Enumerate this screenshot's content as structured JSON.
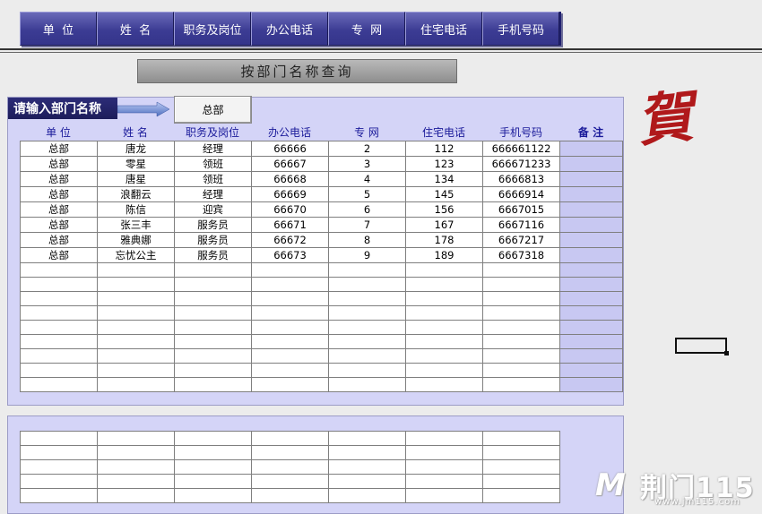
{
  "nav": [
    "单  位",
    "姓  名",
    "职务及岗位",
    "办公电话",
    "专  网",
    "住宅电话",
    "手机号码"
  ],
  "title": "按部门名称查询",
  "prompt_label": "请输入部门名称",
  "dept_value": "总部",
  "columns": [
    "单 位",
    "姓 名",
    "职务及岗位",
    "办公电话",
    "专 网",
    "住宅电话",
    "手机号码"
  ],
  "note_header": "备 注",
  "rows": [
    [
      "总部",
      "唐龙",
      "经理",
      "66666",
      "2",
      "112",
      "666661122"
    ],
    [
      "总部",
      "零星",
      "领班",
      "66667",
      "3",
      "123",
      "666671233"
    ],
    [
      "总部",
      "唐星",
      "领班",
      "66668",
      "4",
      "134",
      "6666813"
    ],
    [
      "总部",
      "浪翻云",
      "经理",
      "66669",
      "5",
      "145",
      "6666914"
    ],
    [
      "总部",
      "陈信",
      "迎宾",
      "66670",
      "6",
      "156",
      "6667015"
    ],
    [
      "总部",
      "张三丰",
      "服务员",
      "66671",
      "7",
      "167",
      "6667116"
    ],
    [
      "总部",
      "雅典娜",
      "服务员",
      "66672",
      "8",
      "178",
      "6667217"
    ],
    [
      "总部",
      "忘忧公主",
      "服务员",
      "66673",
      "9",
      "189",
      "6667318"
    ]
  ],
  "decor_char": "賀",
  "watermark": {
    "name": "荆门115",
    "url": "www.jm115.com"
  },
  "colors": {
    "nav_bg": "#3c3c94",
    "panel_bg": "#d4d4f7",
    "accent_red": "#b0191b"
  }
}
